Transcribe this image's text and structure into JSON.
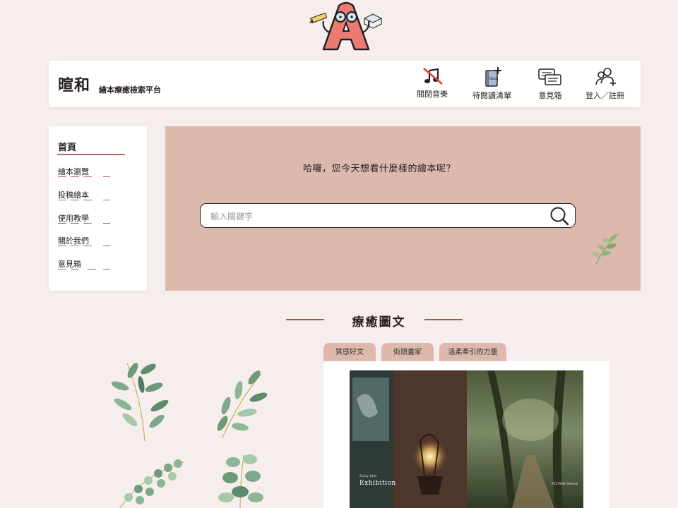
{
  "header": {
    "brand_name": "暄和",
    "brand_subtitle": "繪本療癒檢索平台",
    "buttons": [
      {
        "label": "關閉音樂",
        "icon": "music-off-icon"
      },
      {
        "label": "待閱讀清單",
        "icon": "reading-list-icon"
      },
      {
        "label": "意見箱",
        "icon": "feedback-chat-icon"
      },
      {
        "label": "登入／註冊",
        "icon": "user-add-icon"
      }
    ]
  },
  "sidebar": {
    "title": "首頁",
    "items": [
      {
        "label": "繪本瀏覽"
      },
      {
        "label": "投稿繪本"
      },
      {
        "label": "使用教學"
      },
      {
        "label": "關於我們"
      },
      {
        "label": "意見箱"
      }
    ]
  },
  "hero": {
    "greeting": "哈囉，您今天想看什麼樣的繪本呢？",
    "search_placeholder": "輸入關鍵字",
    "search_icon": "search-icon"
  },
  "section": {
    "title": "療癒圖文",
    "tabs": [
      {
        "label": "質感好文"
      },
      {
        "label": "街頭畫家"
      },
      {
        "label": "溫柔牽引的力量"
      }
    ],
    "featured_image": {
      "caption_small": "Daily Life",
      "caption": "Exhibition",
      "caption_right": "FLOWR Select"
    }
  },
  "colors": {
    "background": "#f5eeec",
    "hero": "#ddb8ad",
    "accent": "#b46a5c"
  }
}
